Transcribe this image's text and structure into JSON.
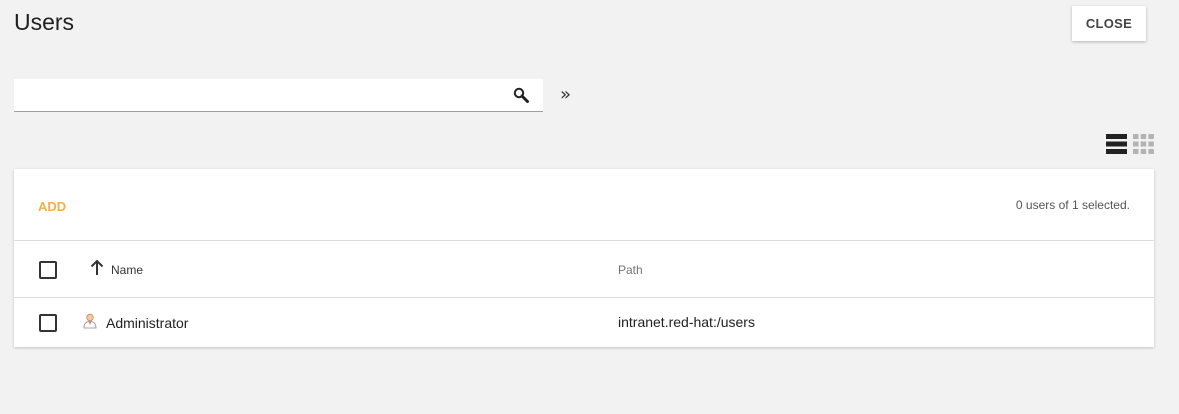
{
  "header": {
    "title": "Users",
    "close_label": "CLOSE"
  },
  "search": {
    "value": "",
    "placeholder": ""
  },
  "filter_toggle": "»",
  "toolbar": {
    "add_label": "ADD",
    "selection_status": "0 users of 1 selected."
  },
  "table": {
    "columns": [
      {
        "label": "Name",
        "sorted": "ascending"
      },
      {
        "label": "Path"
      }
    ],
    "rows": [
      {
        "name": "Administrator",
        "path": "intranet.red-hat:/users",
        "icon": "user-icon"
      }
    ]
  },
  "colors": {
    "accent": "#f5b041",
    "background": "#f2f2f2"
  }
}
